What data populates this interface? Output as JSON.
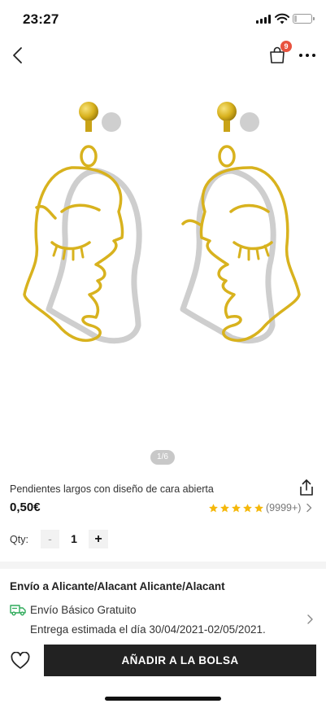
{
  "status_bar": {
    "time": "23:27"
  },
  "nav": {
    "cart_count": "9",
    "icons": [
      "chevron-left-icon",
      "shopping-bag-icon",
      "more-icon"
    ]
  },
  "gallery": {
    "indicator": "1/6",
    "current_image": 1,
    "total_images": 6
  },
  "product": {
    "title": "Pendientes largos con diseño de cara abierta",
    "price": "0,50€",
    "rating_stars": 5,
    "review_count": "(9999+)"
  },
  "quantity": {
    "label": "Qty:",
    "minus": "-",
    "value": "1",
    "plus": "+"
  },
  "shipping": {
    "title": "Envío a Alicante/Alacant Alicante/Alacant",
    "method": "Envío Básico Gratuito",
    "estimate": "Entrega estimada el día 30/04/2021-02/05/2021."
  },
  "bottom_bar": {
    "add_to_bag_label": "AÑADIR A LA BOLSA"
  },
  "colors": {
    "accent_badge": "#e8533f",
    "star": "#f5b80b",
    "shipping_green": "#2eaa5a",
    "button_dark": "#222222",
    "gold": "#d8b21e"
  }
}
